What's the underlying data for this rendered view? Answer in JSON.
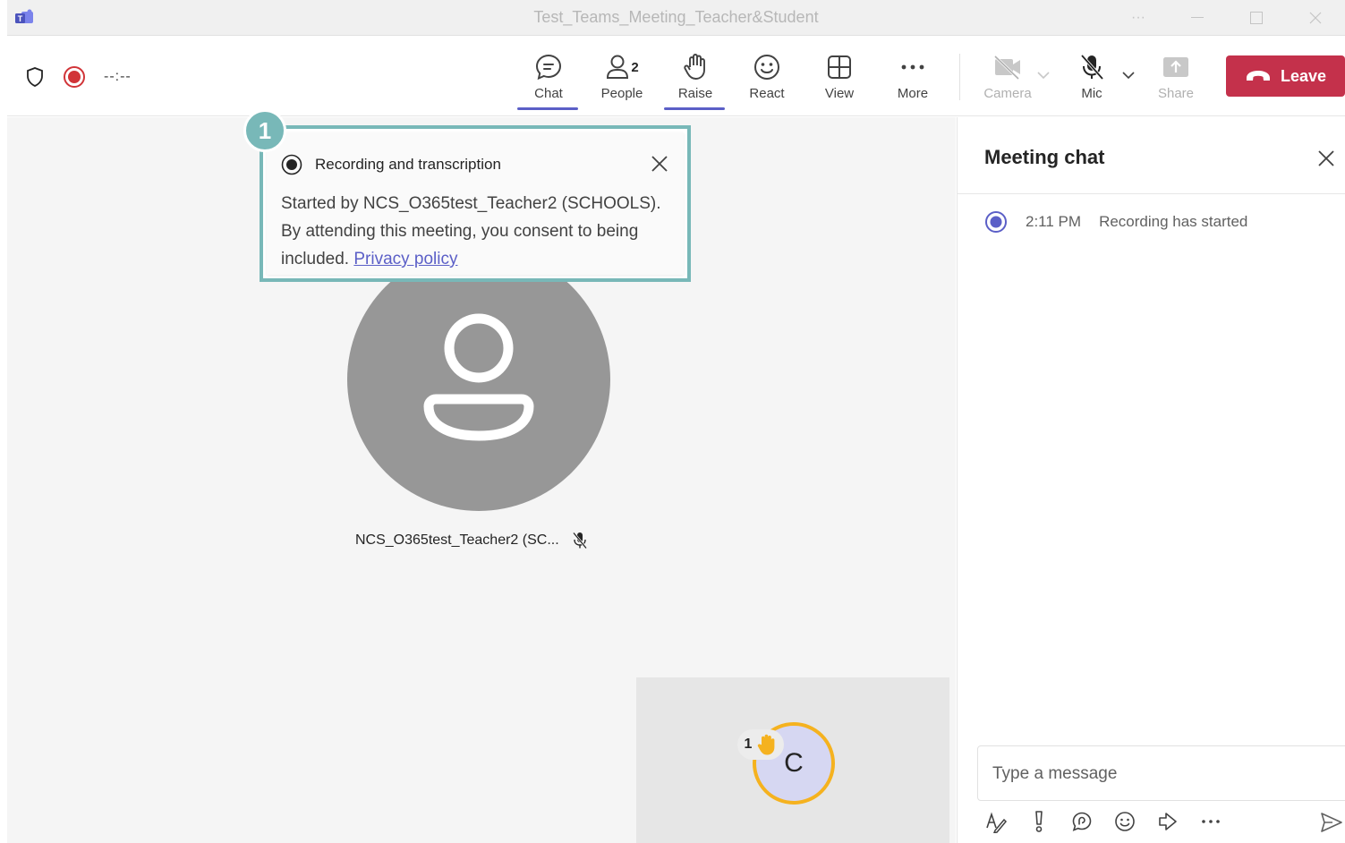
{
  "window": {
    "title": "Test_Teams_Meeting_Teacher&Student",
    "more_label": "···"
  },
  "toolbar": {
    "timer": "--:--",
    "chat_label": "Chat",
    "people_label": "People",
    "people_count": "2",
    "raise_label": "Raise",
    "react_label": "React",
    "view_label": "View",
    "more_label": "More",
    "camera_label": "Camera",
    "mic_label": "Mic",
    "share_label": "Share",
    "leave_label": "Leave"
  },
  "callout": {
    "step": "1",
    "title": "Recording and transcription",
    "body": "Started by NCS_O365test_Teacher2 (SCHOOLS). By attending this meeting, you consent to being included.",
    "link": "Privacy policy"
  },
  "stage": {
    "participant_name": "NCS_O365test_Teacher2 (SC...",
    "self_initial": "C",
    "raised_hands_count": "1"
  },
  "chat": {
    "title": "Meeting chat",
    "event_time": "2:11 PM",
    "event_text": "Recording has started",
    "composer_placeholder": "Type a message"
  },
  "colors": {
    "accent": "#5b5fc7",
    "leave": "#c4314b",
    "record": "#d13438",
    "callout_border": "#78b8b8",
    "raise_ring": "#f5b21f"
  },
  "icons": {
    "app": "teams-logo-icon",
    "shield": "shield-icon",
    "record": "record-icon",
    "chat": "chat-bubble-icon",
    "people": "people-icon",
    "raise": "hand-icon",
    "react": "smiley-icon",
    "view": "grid-icon",
    "more": "ellipsis-icon",
    "camera": "camera-off-icon",
    "mic": "mic-off-icon",
    "share": "share-icon",
    "leave": "phone-hangup-icon"
  }
}
